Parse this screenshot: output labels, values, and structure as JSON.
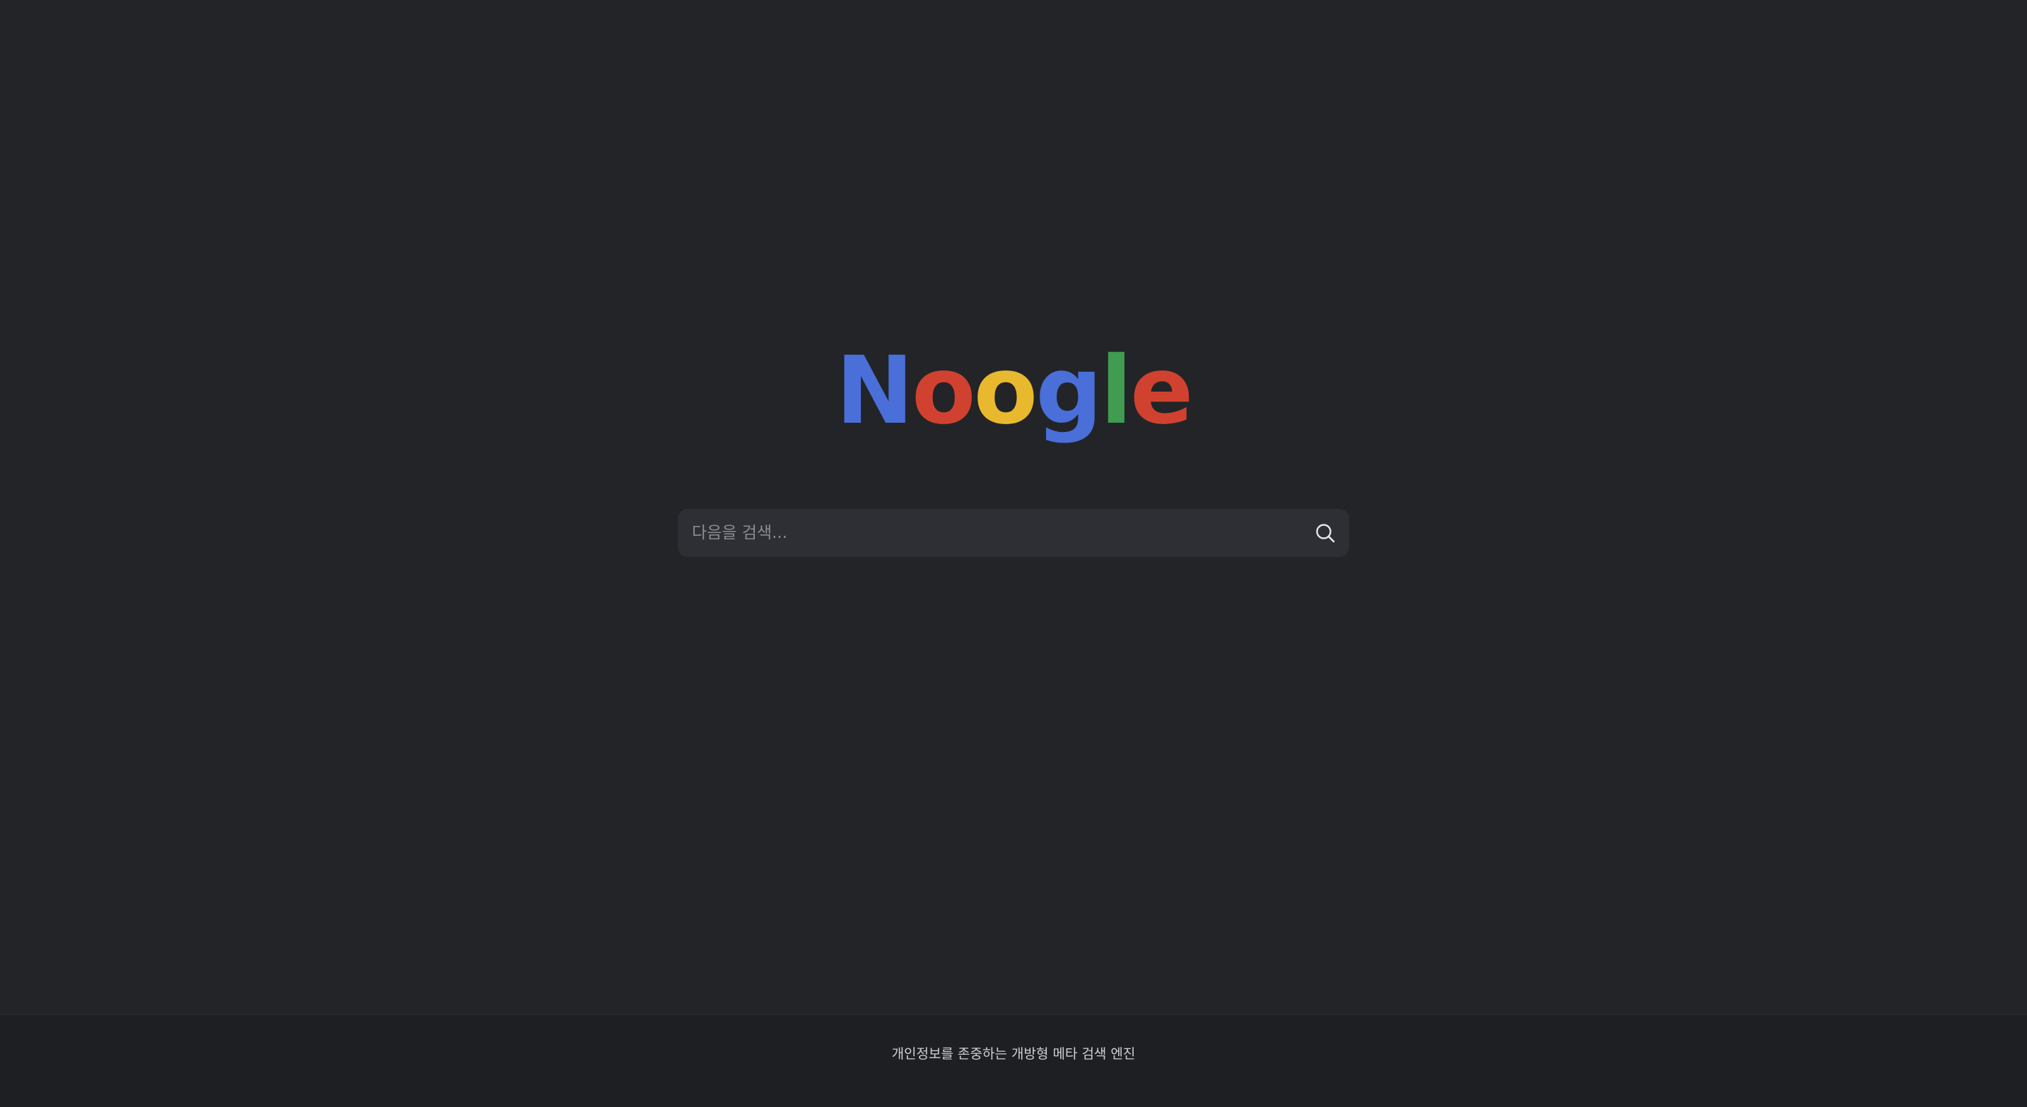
{
  "logo": {
    "letters": [
      {
        "char": "N",
        "color": "#4a6fd8"
      },
      {
        "char": "o",
        "color": "#d0422f"
      },
      {
        "char": "o",
        "color": "#e8b92f"
      },
      {
        "char": "g",
        "color": "#4a6fd8"
      },
      {
        "char": "l",
        "color": "#3f9c50"
      },
      {
        "char": "e",
        "color": "#d0422f"
      }
    ]
  },
  "search": {
    "placeholder": "다음을 검색...",
    "value": "",
    "button_icon": "search-icon"
  },
  "footer": {
    "tagline": "개인정보를 존중하는 개방형 메타 검색 엔진"
  },
  "colors": {
    "background": "#232428",
    "footer_background": "#1e1f23",
    "search_background": "#2e2f34"
  }
}
